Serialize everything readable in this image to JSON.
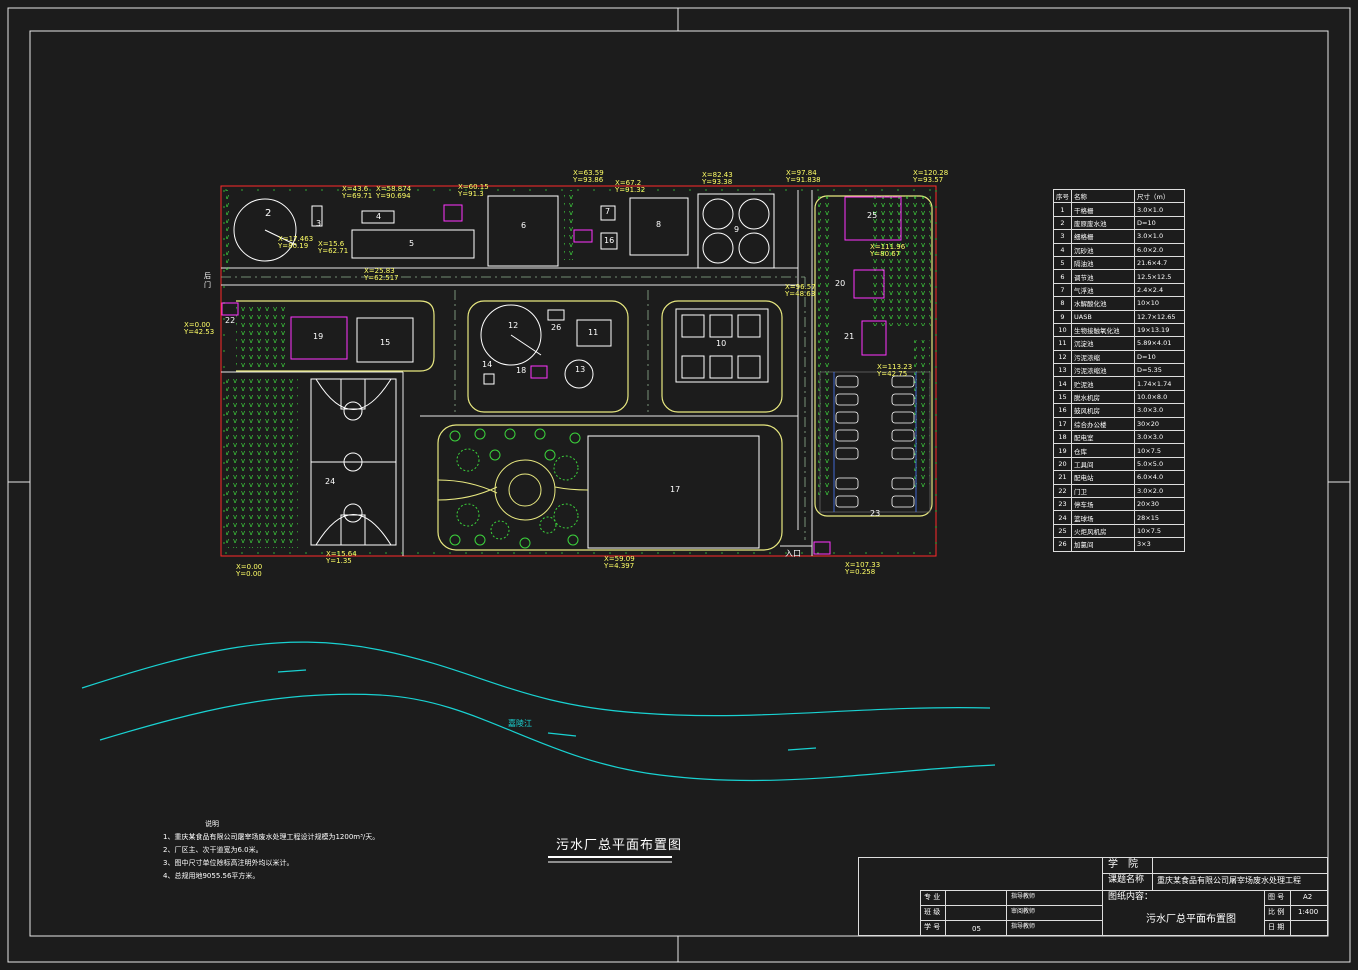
{
  "drawing_title": "污水厂总平面布置图",
  "notes": {
    "heading": "说明",
    "lines": [
      "1、重庆某食品有限公司屠宰场废水处理工程设计规模为1200m³/天。",
      "2、厂区主、次干道宽为6.0米。",
      "3、图中尺寸单位除标高注明外均以米计。",
      "4、总规用地9055.56平方米。"
    ]
  },
  "gate_labels": {
    "rear": "后门",
    "entry": "入口"
  },
  "river_label": "嘉陵江",
  "units": [
    {
      "id": "2"
    },
    {
      "id": "3"
    },
    {
      "id": "4"
    },
    {
      "id": "5"
    },
    {
      "id": "6"
    },
    {
      "id": "7"
    },
    {
      "id": "8"
    },
    {
      "id": "9"
    },
    {
      "id": "10"
    },
    {
      "id": "11"
    },
    {
      "id": "12"
    },
    {
      "id": "13"
    },
    {
      "id": "14"
    },
    {
      "id": "15"
    },
    {
      "id": "16"
    },
    {
      "id": "17"
    },
    {
      "id": "18"
    },
    {
      "id": "19"
    },
    {
      "id": "20"
    },
    {
      "id": "21"
    },
    {
      "id": "22"
    },
    {
      "id": "23"
    },
    {
      "id": "24"
    },
    {
      "id": "25"
    },
    {
      "id": "26"
    }
  ],
  "coordinates": [
    {
      "x": "X=43.6",
      "y": "Y=69.71"
    },
    {
      "x": "X=58.874",
      "y": "Y=90.694"
    },
    {
      "x": "X=60.15",
      "y": "Y=91.3"
    },
    {
      "x": "X=63.59",
      "y": "Y=93.86"
    },
    {
      "x": "X=67.2",
      "y": "Y=91.32"
    },
    {
      "x": "X=82.43",
      "y": "Y=93.38"
    },
    {
      "x": "X=97.84",
      "y": "Y=91.838"
    },
    {
      "x": "X=120.28",
      "y": "Y=93.57"
    },
    {
      "x": "X=17.463",
      "y": "Y=80.19"
    },
    {
      "x": "X=15.6",
      "y": "Y=62.71"
    },
    {
      "x": "X=25.83",
      "y": "Y=62.517"
    },
    {
      "x": "X=0.00",
      "y": "Y=42.53"
    },
    {
      "x": "X=111.96",
      "y": "Y=80.67"
    },
    {
      "x": "X=96.57",
      "y": "Y=48.63"
    },
    {
      "x": "X=113.23",
      "y": "Y=42.75"
    },
    {
      "x": "X=107.33",
      "y": "Y=0.258"
    },
    {
      "x": "X=0.00",
      "y": "Y=0.00"
    },
    {
      "x": "X=15.64",
      "y": "Y=1.35"
    },
    {
      "x": "X=59.09",
      "y": "Y=4.397"
    }
  ],
  "legend": {
    "headers": [
      "序号",
      "名称",
      "尺寸（m）"
    ],
    "rows": [
      [
        "1",
        "干格栅",
        "3.0×1.0"
      ],
      [
        "2",
        "废原废水池",
        "D=10"
      ],
      [
        "3",
        "细格栅",
        "3.0×1.0"
      ],
      [
        "4",
        "沉砂池",
        "6.0×2.0"
      ],
      [
        "5",
        "隔油池",
        "21.6×4.7"
      ],
      [
        "6",
        "调节池",
        "12.5×12.5"
      ],
      [
        "7",
        "气浮池",
        "2.4×2.4"
      ],
      [
        "8",
        "水解酸化池",
        "10×10"
      ],
      [
        "9",
        "UASB",
        "12.7×12.65"
      ],
      [
        "10",
        "生物接触氧化池",
        "19×13.19"
      ],
      [
        "11",
        "沉淀池",
        "5.89×4.01"
      ],
      [
        "12",
        "污泥浓缩",
        "D=10"
      ],
      [
        "13",
        "污泥浓缩池",
        "D=5.35"
      ],
      [
        "14",
        "贮泥池",
        "1.74×1.74"
      ],
      [
        "15",
        "脱水机房",
        "10.0×8.0"
      ],
      [
        "16",
        "鼓风机房",
        "3.0×3.0"
      ],
      [
        "17",
        "综合办公楼",
        "30×20"
      ],
      [
        "18",
        "配电室",
        "3.0×3.0"
      ],
      [
        "19",
        "仓库",
        "10×7.5"
      ],
      [
        "20",
        "工具间",
        "5.0×5.0"
      ],
      [
        "21",
        "配电站",
        "6.0×4.0"
      ],
      [
        "22",
        "门卫",
        "3.0×2.0"
      ],
      [
        "23",
        "停车场",
        "20×30"
      ],
      [
        "24",
        "篮球场",
        "28×15"
      ],
      [
        "25",
        "火炬风机房",
        "10×7.5"
      ],
      [
        "26",
        "加氯间",
        "3×3"
      ]
    ]
  },
  "title_block": {
    "school": "学　院",
    "project_label": "课题名称",
    "project_value": "重庆某食品有限公司屠宰场废水处理工程",
    "content_label": "图纸内容：",
    "content_value": "污水厂总平面布置图",
    "row_labels": [
      "专 业",
      "班 级",
      "学 号"
    ],
    "sign_labels": [
      "指导教师",
      "审阅教师",
      "指导教师"
    ],
    "student_no": "05",
    "right_labels": [
      "图 号",
      "比 例",
      "日 期"
    ],
    "right_values": [
      "A2",
      "1:400",
      ""
    ]
  }
}
